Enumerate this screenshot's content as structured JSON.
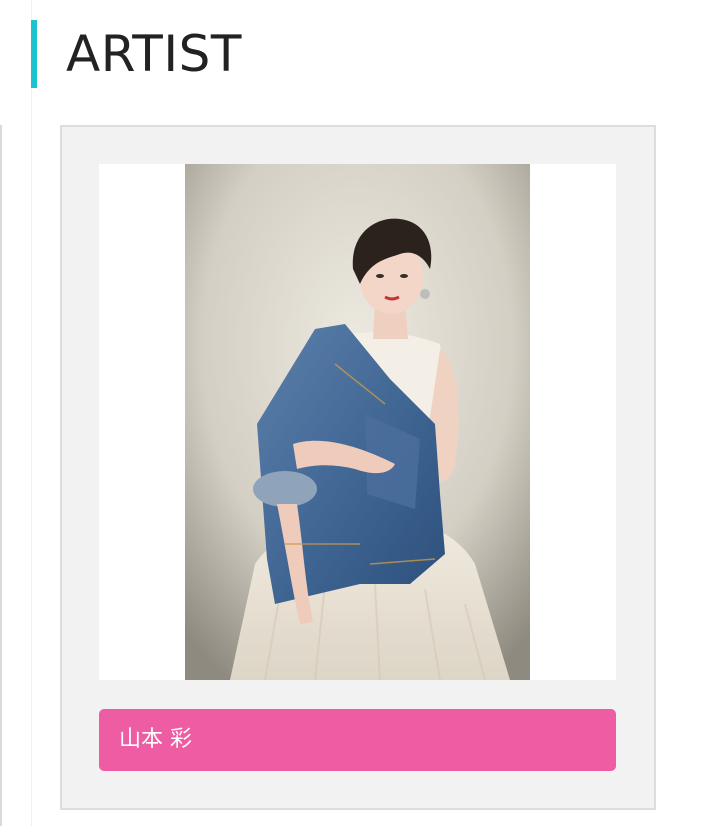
{
  "section": {
    "title": "ARTIST",
    "accent_color": "#1bc3cf"
  },
  "artist_card": {
    "photo_alt": "山本 彩",
    "name": "山本 彩",
    "name_bg_color": "#ee5da4"
  }
}
